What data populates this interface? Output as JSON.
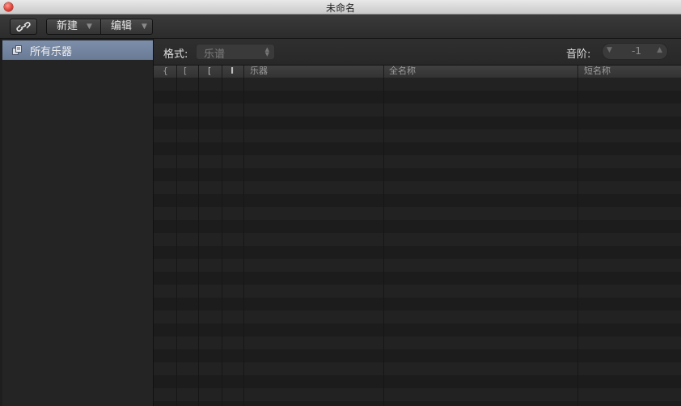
{
  "window": {
    "title": "未命名"
  },
  "toolbar": {
    "new_label": "新建",
    "edit_label": "编辑",
    "link_icon": "link-icon",
    "arrow": "▼"
  },
  "sidebar": {
    "items": [
      {
        "label": "所有乐器",
        "icon": "instrument-set-icon",
        "selected": true
      }
    ]
  },
  "controls": {
    "format_label": "格式:",
    "format_value": "乐谱",
    "octave_label": "音阶:",
    "octave_value": "-1"
  },
  "table": {
    "columns": [
      "{",
      "[",
      "[",
      "I",
      "乐器",
      "全名称",
      "短名称"
    ]
  },
  "colors": {
    "selection": "#7486a2",
    "background": "#1e1e1e",
    "close_button": "#e0443a"
  }
}
